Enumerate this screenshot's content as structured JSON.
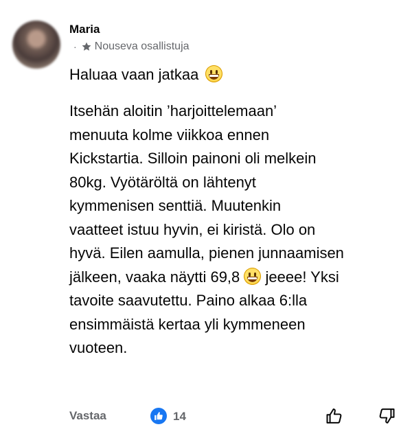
{
  "comment": {
    "author": "Maria",
    "separator": "·",
    "badge_label": "Nouseva osallistuja",
    "headline": "Haluaa vaan jatkaa",
    "body_part1": "Itsehän aloitin ’harjoittelemaan’\nmenuuta kolme viikkoa ennen\nKickstartia. Silloin painoni oli melkein\n80kg. Vyötäröltä on lähtenyt\nkymmenisen senttiä. Muutenkin\nvaatteet istuu hyvin, ei kiristä. Olo on\nhyvä. Eilen aamulla, pienen junnaamisen\njälkeen, vaaka näytti 69,8 ",
    "body_part2": " jeeee! Yksi\ntavoite saavutettu. Paino alkaa 6:lla\nensimmäistä kertaa yli kymmeneen\nvuoteen."
  },
  "footer": {
    "reply_label": "Vastaa",
    "like_count": "14"
  },
  "icons": {
    "badge": "star-icon",
    "headline_emoji": "grinning-squinting-face-icon",
    "body_emoji": "grinning-face-icon",
    "reaction": "thumbs-up-icon",
    "upvote": "thumbs-up-outline-icon",
    "downvote": "thumbs-down-outline-icon"
  },
  "colors": {
    "text": "#050505",
    "secondary": "#65676b",
    "like_blue": "#1877f2"
  }
}
